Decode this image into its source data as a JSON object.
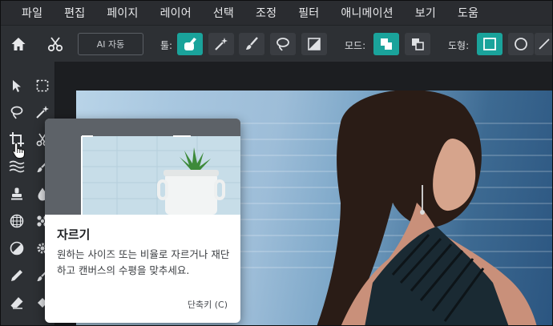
{
  "menu": {
    "items": [
      "파일",
      "편집",
      "페이지",
      "레이어",
      "선택",
      "조정",
      "필터",
      "애니메이션",
      "보기",
      "도움"
    ]
  },
  "toolbar": {
    "ai_button_label": "AI 자동",
    "tools_label": "툴:",
    "mode_label": "모드:",
    "shape_label": "도형:"
  },
  "tooltip": {
    "title": "자르기",
    "description": "원하는 사이즈 또는 비율로 자르거나 재단하고 캔버스의 수평을 맞추세요.",
    "shortcut": "단축키 (C)"
  },
  "colors": {
    "accent": "#1aa39b",
    "menubar_bg": "#2a2c30",
    "toolbar_bg": "#2d3034",
    "canvas_bg": "#1c1e21",
    "tooltip_bg": "#ffffff"
  },
  "icons": {
    "toolbar": [
      "home-icon",
      "scissors-icon",
      "brush-select-icon",
      "magic-wand-icon",
      "paintbrush-icon",
      "lasso-icon",
      "gradient-square-icon",
      "mode-union-icon",
      "mode-subtract-icon",
      "square-shape-icon",
      "circle-shape-icon",
      "line-shape-icon"
    ],
    "tools": [
      "arrow-icon",
      "marquee-icon",
      "lasso-icon",
      "magic-wand-icon",
      "crop-icon",
      "scissors-icon",
      "wave-icon",
      "brush-icon",
      "stamp-icon",
      "drop-icon",
      "grid-circle-icon",
      "dots-icon",
      "half-circle-icon",
      "gear-icon",
      "pencil-icon",
      "paintbrush-icon",
      "eraser-icon",
      "fill-icon"
    ],
    "cursor": "hand-pointer-icon"
  }
}
